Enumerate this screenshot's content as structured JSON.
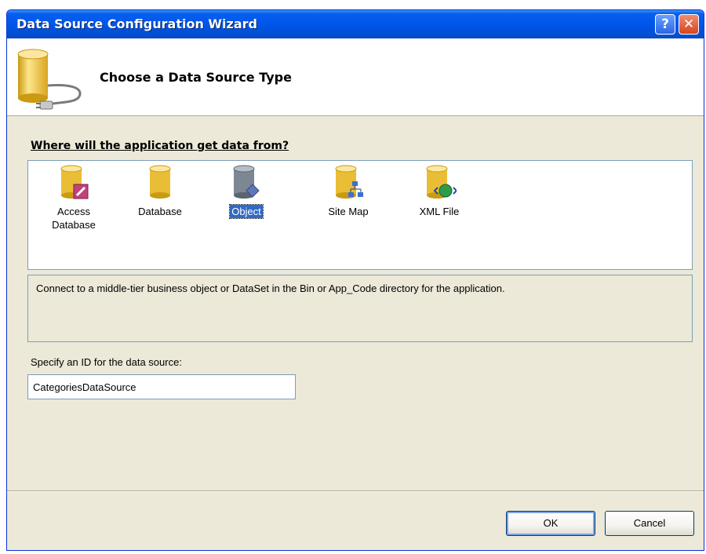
{
  "window": {
    "title": "Data Source Configuration Wizard",
    "help_label": "?",
    "close_label": "✕"
  },
  "header": {
    "title": "Choose a Data Source Type",
    "icon": "database-plug-icon"
  },
  "source_types": {
    "question": "Where will the application get data from?",
    "items": [
      {
        "label_line1": "Access",
        "label_line2": "Database",
        "icon": "access-database-icon",
        "selected": false
      },
      {
        "label_line1": "Database",
        "label_line2": "",
        "icon": "database-icon",
        "selected": false
      },
      {
        "label_line1": "Object",
        "label_line2": "",
        "icon": "object-icon",
        "selected": true
      },
      {
        "label_line1": "Site Map",
        "label_line2": "",
        "icon": "site-map-icon",
        "selected": false
      },
      {
        "label_line1": "XML File",
        "label_line2": "",
        "icon": "xml-file-icon",
        "selected": false
      }
    ]
  },
  "description": "Connect to a middle-tier business object or DataSet in the Bin or App_Code directory for the application.",
  "id_field": {
    "label": "Specify an ID for the data source:",
    "value": "CategoriesDataSource"
  },
  "buttons": {
    "ok": "OK",
    "cancel": "Cancel"
  },
  "colors": {
    "titlebar": "#0058ee",
    "selection": "#316ac5",
    "cylinder": "#f2c640"
  }
}
